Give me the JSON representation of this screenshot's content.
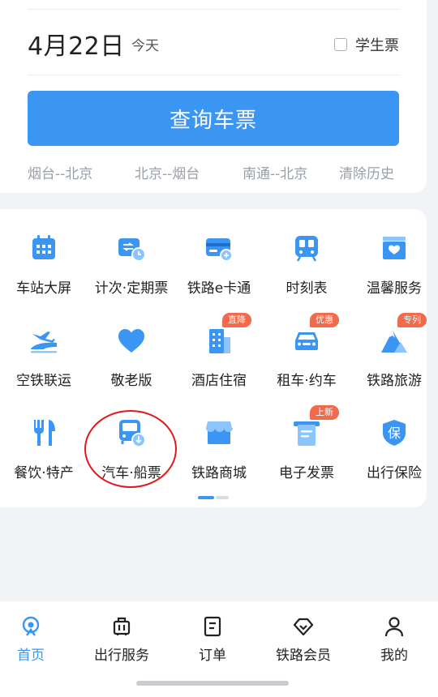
{
  "search": {
    "date": "4月22日",
    "today": "今天",
    "student_label": "学生票",
    "query_button": "查询车票",
    "history": [
      "烟台--北京",
      "北京--烟台",
      "南通--北京"
    ],
    "clear_history": "清除历史"
  },
  "services": {
    "row1": [
      {
        "label": "车站大屏",
        "icon": "calendar-icon"
      },
      {
        "label": "计次·定期票",
        "icon": "ticket-clock-icon"
      },
      {
        "label": "铁路e卡通",
        "icon": "card-icon"
      },
      {
        "label": "时刻表",
        "icon": "train-front-icon"
      },
      {
        "label": "温馨服务",
        "icon": "heart-box-icon"
      }
    ],
    "row2": [
      {
        "label": "空铁联运",
        "icon": "plane-train-icon"
      },
      {
        "label": "敬老版",
        "icon": "heart-icon"
      },
      {
        "label": "酒店住宿",
        "icon": "hotel-icon",
        "badge": "直降"
      },
      {
        "label": "租车·约车",
        "icon": "car-icon",
        "badge": "优惠"
      },
      {
        "label": "铁路旅游",
        "icon": "mountain-icon",
        "badge": "专列"
      }
    ],
    "row3": [
      {
        "label": "餐饮·特产",
        "icon": "fork-knife-icon"
      },
      {
        "label": "汽车·船票",
        "icon": "bus-icon"
      },
      {
        "label": "铁路商城",
        "icon": "shop-icon"
      },
      {
        "label": "电子发票",
        "icon": "invoice-icon",
        "badge": "上新"
      },
      {
        "label": "出行保险",
        "icon": "insurance-icon"
      }
    ],
    "insurance_glyph": "保"
  },
  "nav": [
    {
      "label": "首页",
      "icon": "home-icon",
      "active": true
    },
    {
      "label": "出行服务",
      "icon": "luggage-icon"
    },
    {
      "label": "订单",
      "icon": "order-icon"
    },
    {
      "label": "铁路会员",
      "icon": "diamond-icon"
    },
    {
      "label": "我的",
      "icon": "user-icon"
    }
  ],
  "colors": {
    "accent": "#3b95f2",
    "badge": "#f26a4b",
    "highlight_circle": "#e0181b"
  }
}
